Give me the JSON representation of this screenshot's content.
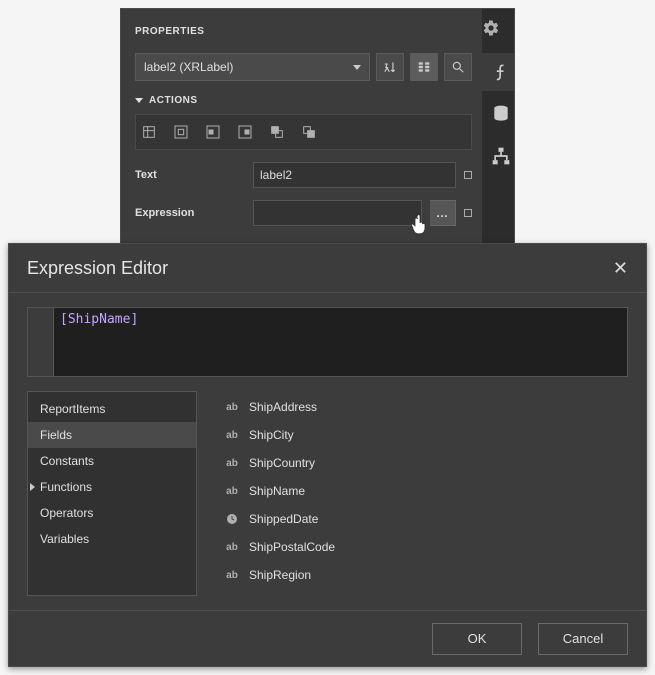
{
  "properties": {
    "title": "PROPERTIES",
    "selected_object": "label2 (XRLabel)",
    "section_actions": "ACTIONS",
    "rows": {
      "text": {
        "label": "Text",
        "value": "label2"
      },
      "expression": {
        "label": "Expression",
        "value": ""
      }
    },
    "ellipsis": "…"
  },
  "rail": {
    "items": [
      {
        "name": "expressions",
        "active": true
      },
      {
        "name": "data",
        "active": false
      },
      {
        "name": "report-tree",
        "active": false
      }
    ]
  },
  "modal": {
    "title": "Expression Editor",
    "close_glyph": "✕",
    "expression_text": "[ShipName]",
    "categories": [
      {
        "label": "ReportItems",
        "selected": false,
        "expandable": false
      },
      {
        "label": "Fields",
        "selected": true,
        "expandable": false
      },
      {
        "label": "Constants",
        "selected": false,
        "expandable": false
      },
      {
        "label": "Functions",
        "selected": false,
        "expandable": true
      },
      {
        "label": "Operators",
        "selected": false,
        "expandable": false
      },
      {
        "label": "Variables",
        "selected": false,
        "expandable": false
      }
    ],
    "fields": [
      {
        "icon": "ab",
        "label": "ShipAddress"
      },
      {
        "icon": "ab",
        "label": "ShipCity"
      },
      {
        "icon": "ab",
        "label": "ShipCountry"
      },
      {
        "icon": "ab",
        "label": "ShipName"
      },
      {
        "icon": "clock",
        "label": "ShippedDate"
      },
      {
        "icon": "ab",
        "label": "ShipPostalCode"
      },
      {
        "icon": "ab",
        "label": "ShipRegion"
      }
    ],
    "buttons": {
      "ok": "OK",
      "cancel": "Cancel"
    }
  }
}
